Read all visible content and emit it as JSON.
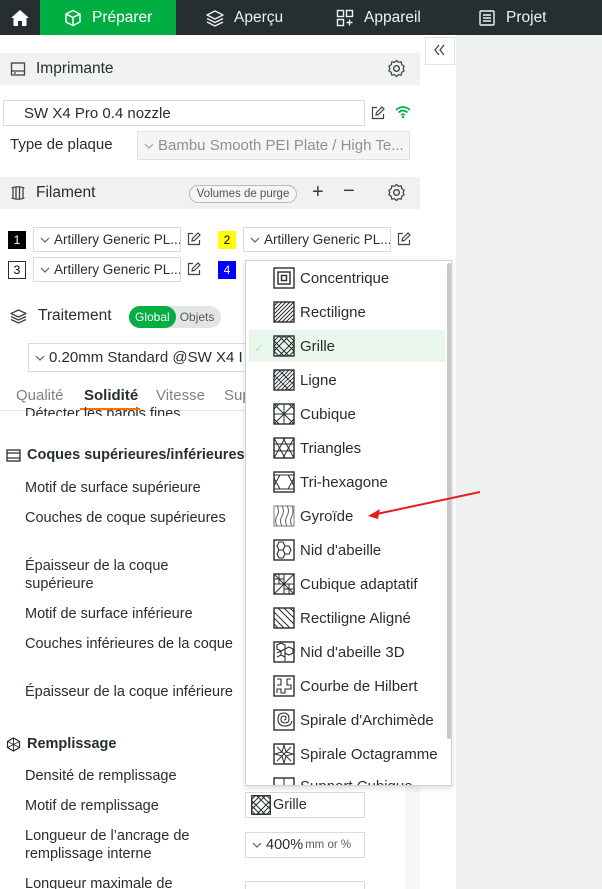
{
  "topbar": {
    "tabs": [
      {
        "label": "Préparer",
        "icon": "cube-icon",
        "active": true
      },
      {
        "label": "Aperçu",
        "icon": "layers-icon",
        "active": false
      },
      {
        "label": "Appareil",
        "icon": "device-icon",
        "active": false
      },
      {
        "label": "Projet",
        "icon": "project-icon",
        "active": false
      }
    ]
  },
  "printer": {
    "title": "Imprimante",
    "selected": "SW X4 Pro 0.4 nozzle",
    "plate_label": "Type de plaque",
    "plate_value": "Bambu Smooth PEI Plate / High Te..."
  },
  "filament": {
    "title": "Filament",
    "purge_label": "Volumes de purge",
    "plus": "+",
    "minus": "−",
    "slots": [
      {
        "num": "1",
        "name": "Artillery Generic PL...",
        "color": "#000000",
        "text_color": "#ffffff"
      },
      {
        "num": "2",
        "name": "Artillery Generic PL...",
        "color": "#ffff00",
        "text_color": "#000000"
      },
      {
        "num": "3",
        "name": "Artillery Generic PL...",
        "color": "#ffffff",
        "text_color": "#000000"
      },
      {
        "num": "4",
        "name": "",
        "color": "#0000ff",
        "text_color": "#ffffff"
      }
    ]
  },
  "process": {
    "title": "Traitement",
    "toggle_on": "Global",
    "toggle_off": "Objets",
    "preset": "0.20mm Standard @SW X4 I"
  },
  "subtabs": [
    "Qualité",
    "Solidité",
    "Vitesse",
    "Sup"
  ],
  "settings": {
    "cut_row": "Détecter les parois fines",
    "shells_title": "Coques supérieures/inférieures",
    "top_pattern": "Motif de surface supérieure",
    "top_layers": "Couches de coque supérieures",
    "top_thickness": "Épaisseur de la coque supérieure",
    "bottom_pattern": "Motif de surface inférieure",
    "bottom_layers": "Couches inférieures de la coque",
    "bottom_thickness": "Épaisseur de la coque inférieure",
    "infill_title": "Remplissage",
    "infill_density": "Densité de remplissage",
    "infill_pattern": "Motif de remplissage",
    "infill_pattern_value": "Grille",
    "anchor_len": "Longueur de l’ancrage de remplissage interne",
    "anchor_value": "400%",
    "anchor_unit": "mm or %",
    "anchor_max": "Longueur maximale de"
  },
  "dropdown": {
    "selected": "Grille",
    "options": [
      {
        "label": "Concentrique",
        "icon": "concentric-icon"
      },
      {
        "label": "Rectiligne",
        "icon": "rectilinear-icon"
      },
      {
        "label": "Grille",
        "icon": "grid-icon"
      },
      {
        "label": "Ligne",
        "icon": "line-icon"
      },
      {
        "label": "Cubique",
        "icon": "cubic-icon"
      },
      {
        "label": "Triangles",
        "icon": "triangles-icon"
      },
      {
        "label": "Tri-hexagone",
        "icon": "tri-hexagon-icon"
      },
      {
        "label": "Gyroïde",
        "icon": "gyroid-icon"
      },
      {
        "label": "Nid d'abeille",
        "icon": "honeycomb-icon"
      },
      {
        "label": "Cubique adaptatif",
        "icon": "adaptive-cubic-icon"
      },
      {
        "label": "Rectiligne Aligné",
        "icon": "aligned-rectilinear-icon"
      },
      {
        "label": "Nid d'abeille 3D",
        "icon": "honeycomb-3d-icon"
      },
      {
        "label": "Courbe de Hilbert",
        "icon": "hilbert-curve-icon"
      },
      {
        "label": "Spirale d'Archimède",
        "icon": "archimedean-spiral-icon"
      },
      {
        "label": "Spirale Octagramme",
        "icon": "octagram-spiral-icon"
      },
      {
        "label": "Support Cubique",
        "icon": "support-cubic-icon"
      }
    ]
  },
  "colors": {
    "accent": "#00ae42",
    "topbar": "#262e30",
    "underline": "#ff6f00",
    "annotation": "#e02020"
  }
}
